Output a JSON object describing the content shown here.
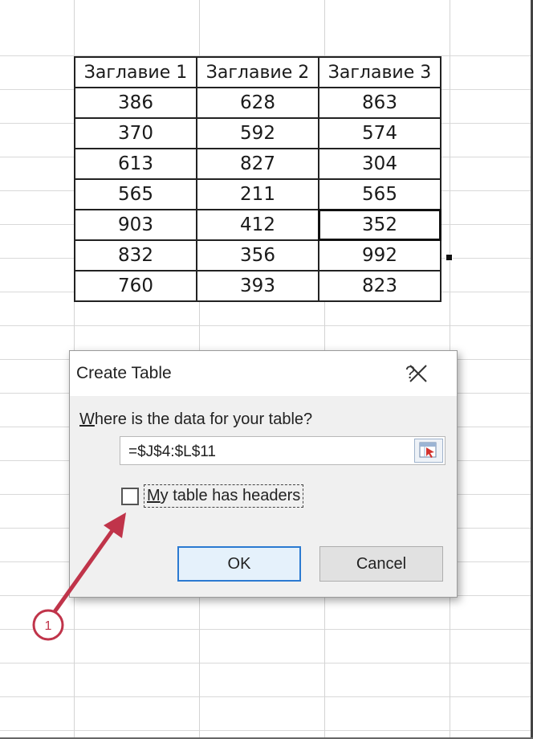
{
  "table": {
    "headers": [
      "Заглавие 1",
      "Заглавие 2",
      "Заглавие 3"
    ],
    "rows": [
      [
        "386",
        "628",
        "863"
      ],
      [
        "370",
        "592",
        "574"
      ],
      [
        "613",
        "827",
        "304"
      ],
      [
        "565",
        "211",
        "565"
      ],
      [
        "903",
        "412",
        "352"
      ],
      [
        "832",
        "356",
        "992"
      ],
      [
        "760",
        "393",
        "823"
      ]
    ]
  },
  "dialog": {
    "title": "Create Table",
    "help_label": "?",
    "prompt_first": "W",
    "prompt_rest": "here is the data for your table?",
    "range_value": "=$J$4:$L$11",
    "checkbox_first": "M",
    "checkbox_rest": "y table has headers",
    "checkbox_checked": false,
    "ok_label": "OK",
    "cancel_label": "Cancel"
  },
  "annotation": {
    "number": "1",
    "color": "#c0344a"
  },
  "colors": {
    "ok_border": "#2b7ad1",
    "selection_border": "#111111"
  }
}
